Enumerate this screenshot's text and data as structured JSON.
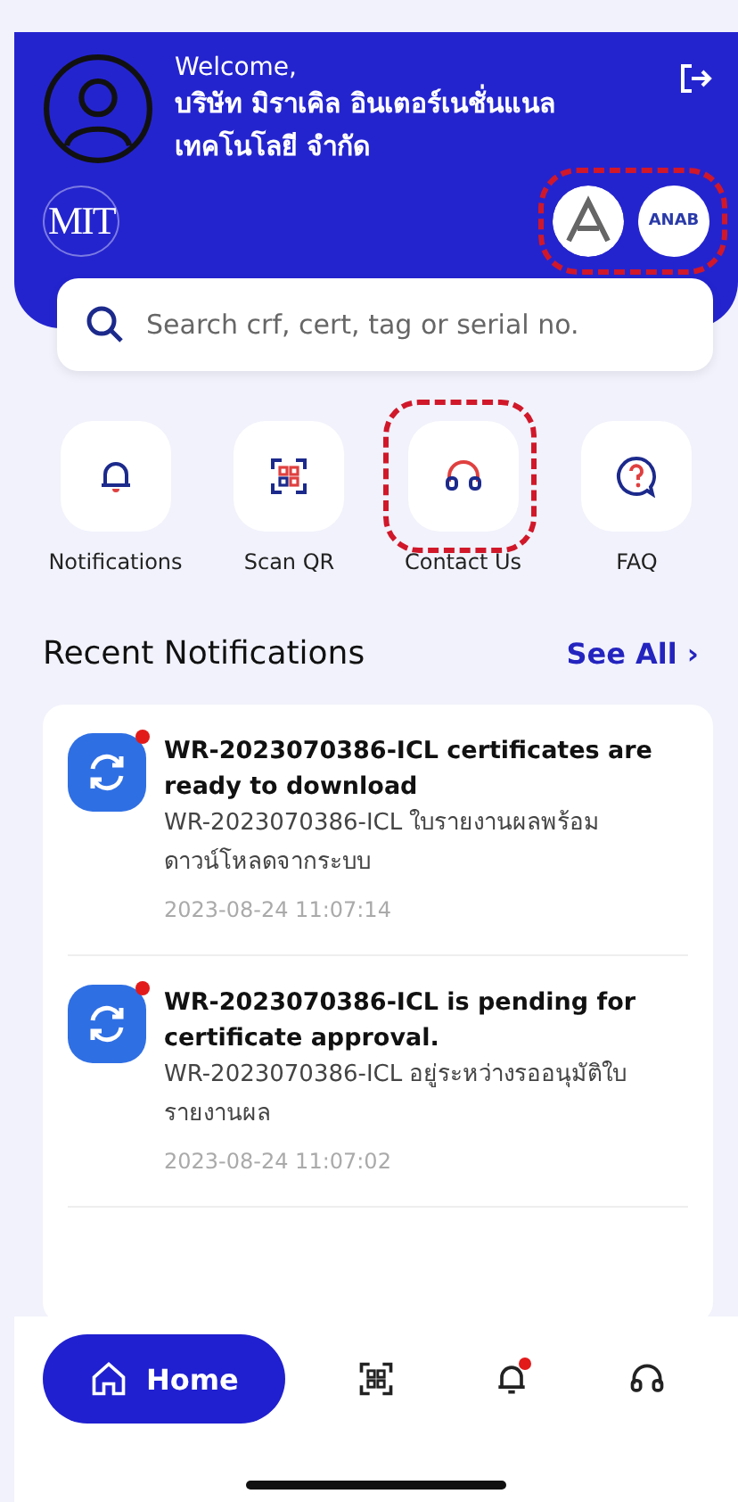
{
  "header": {
    "greeting": "Welcome,",
    "company": "บริษัท มิราเคิล อินเตอร์เนชั่นแนล เทคโนโลยี จำกัด",
    "logo": "MIT",
    "badges": [
      {
        "kind": "iac"
      },
      {
        "kind": "anab",
        "label": "ANAB"
      }
    ]
  },
  "search": {
    "placeholder": "Search crf, cert, tag or serial no."
  },
  "quick_actions": [
    {
      "kind": "bell",
      "label": "Notifications",
      "highlighted": false
    },
    {
      "kind": "qr",
      "label": "Scan QR",
      "highlighted": false
    },
    {
      "kind": "headset",
      "label": "Contact Us",
      "highlighted": true
    },
    {
      "kind": "faq",
      "label": "FAQ",
      "highlighted": false
    }
  ],
  "recent": {
    "title": "Recent Notifications",
    "see_all": "See All",
    "chevron": "›"
  },
  "notifications": [
    {
      "title": "WR-2023070386-ICL certificates are ready to download",
      "body": "WR-2023070386-ICL ใบรายงานผลพร้อมดาวน์โหลดจากระบบ",
      "time": "2023-08-24 11:07:14",
      "unread": true
    },
    {
      "title": "WR-2023070386-ICL is pending for certificate approval.",
      "body": "WR-2023070386-ICL อยู่ระหว่างรออนุมัติใบรายงานผล",
      "time": "2023-08-24 11:07:02",
      "unread": true
    }
  ],
  "nav": [
    {
      "kind": "home",
      "label": "Home",
      "selected": true,
      "dot": false
    },
    {
      "kind": "qr",
      "selected": false,
      "dot": false
    },
    {
      "kind": "bell",
      "selected": false,
      "dot": true
    },
    {
      "kind": "headset",
      "selected": false,
      "dot": false
    }
  ]
}
